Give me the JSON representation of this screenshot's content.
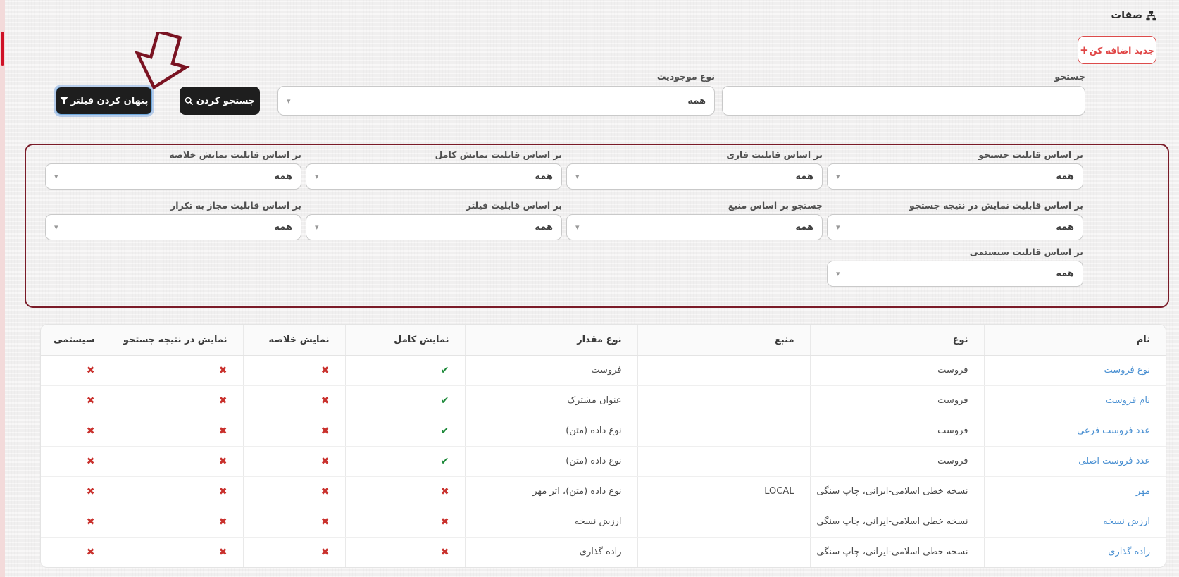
{
  "header": {
    "title": "صفات"
  },
  "actions": {
    "add_new": "جدید اضافه کن",
    "plus": "+"
  },
  "search": {
    "label": "جستجو",
    "value": "",
    "entity_type_label": "نوع موجودیت",
    "entity_type_value": "همه",
    "search_button": "جستجو کردن",
    "hide_filter_button": "پنهان کردن فیلتر"
  },
  "filters": {
    "items": [
      {
        "label": "بر اساس قابلیت جستجو",
        "value": "همه"
      },
      {
        "label": "بر اساس قابلیت فازی",
        "value": "همه"
      },
      {
        "label": "بر اساس قابلیت نمایش کامل",
        "value": "همه"
      },
      {
        "label": "بر اساس قابلیت نمایش خلاصه",
        "value": "همه"
      },
      {
        "label": "بر اساس قابلیت نمایش در نتیجه جستجو",
        "value": "همه"
      },
      {
        "label": "جستجو بر اساس منبع",
        "value": "همه"
      },
      {
        "label": "بر اساس قابلیت فیلتر",
        "value": "همه"
      },
      {
        "label": "بر اساس قابلیت مجاز به تکرار",
        "value": "همه"
      },
      {
        "label": "بر اساس قابلیت سیستمی",
        "value": "همه"
      }
    ]
  },
  "table": {
    "headers": {
      "name": "نام",
      "type": "نوع",
      "source": "منبع",
      "value_type": "نوع مقدار",
      "full_display": "نمایش کامل",
      "summary_display": "نمایش خلاصه",
      "search_result_display": "نمایش در نتیجه جستجو",
      "system": "سیستمی"
    },
    "rows": [
      {
        "name": "نوع فروست",
        "type": "فروست",
        "source": "",
        "value_type": "فروست",
        "full": "✔",
        "summary": "✖",
        "in_search": "✖",
        "system": "✖"
      },
      {
        "name": "نام فروست",
        "type": "فروست",
        "source": "",
        "value_type": "عنوان مشترک",
        "full": "✔",
        "summary": "✖",
        "in_search": "✖",
        "system": "✖"
      },
      {
        "name": "عدد فروست فرعی",
        "type": "فروست",
        "source": "",
        "value_type": "نوع داده (متن)",
        "full": "✔",
        "summary": "✖",
        "in_search": "✖",
        "system": "✖"
      },
      {
        "name": "عدد فروست اصلی",
        "type": "فروست",
        "source": "",
        "value_type": "نوع داده (متن)",
        "full": "✔",
        "summary": "✖",
        "in_search": "✖",
        "system": "✖"
      },
      {
        "name": "مهر",
        "type": "نسخه خطی اسلامی-ایرانی، چاپ سنگی",
        "source": "LOCAL",
        "value_type": "نوع داده (متن)، اثر مهر",
        "full": "✖",
        "summary": "✖",
        "in_search": "✖",
        "system": "✖"
      },
      {
        "name": "ارزش نسخه",
        "type": "نسخه خطی اسلامی-ایرانی، چاپ سنگی",
        "source": "",
        "value_type": "ارزش نسخه",
        "full": "✖",
        "summary": "✖",
        "in_search": "✖",
        "system": "✖"
      },
      {
        "name": "راده گذاری",
        "type": "نسخه خطی اسلامی-ایرانی، چاپ سنگی",
        "source": "",
        "value_type": "راده گذاری",
        "full": "✖",
        "summary": "✖",
        "in_search": "✖",
        "system": "✖"
      }
    ]
  },
  "colors": {
    "panel_border_red": "#7a1b28",
    "accent_red": "#e04545",
    "link_blue": "#4a90d2",
    "check_green": "#1f8a3b",
    "cross_red": "#c9302c",
    "button_dark": "#1e1e1e"
  }
}
